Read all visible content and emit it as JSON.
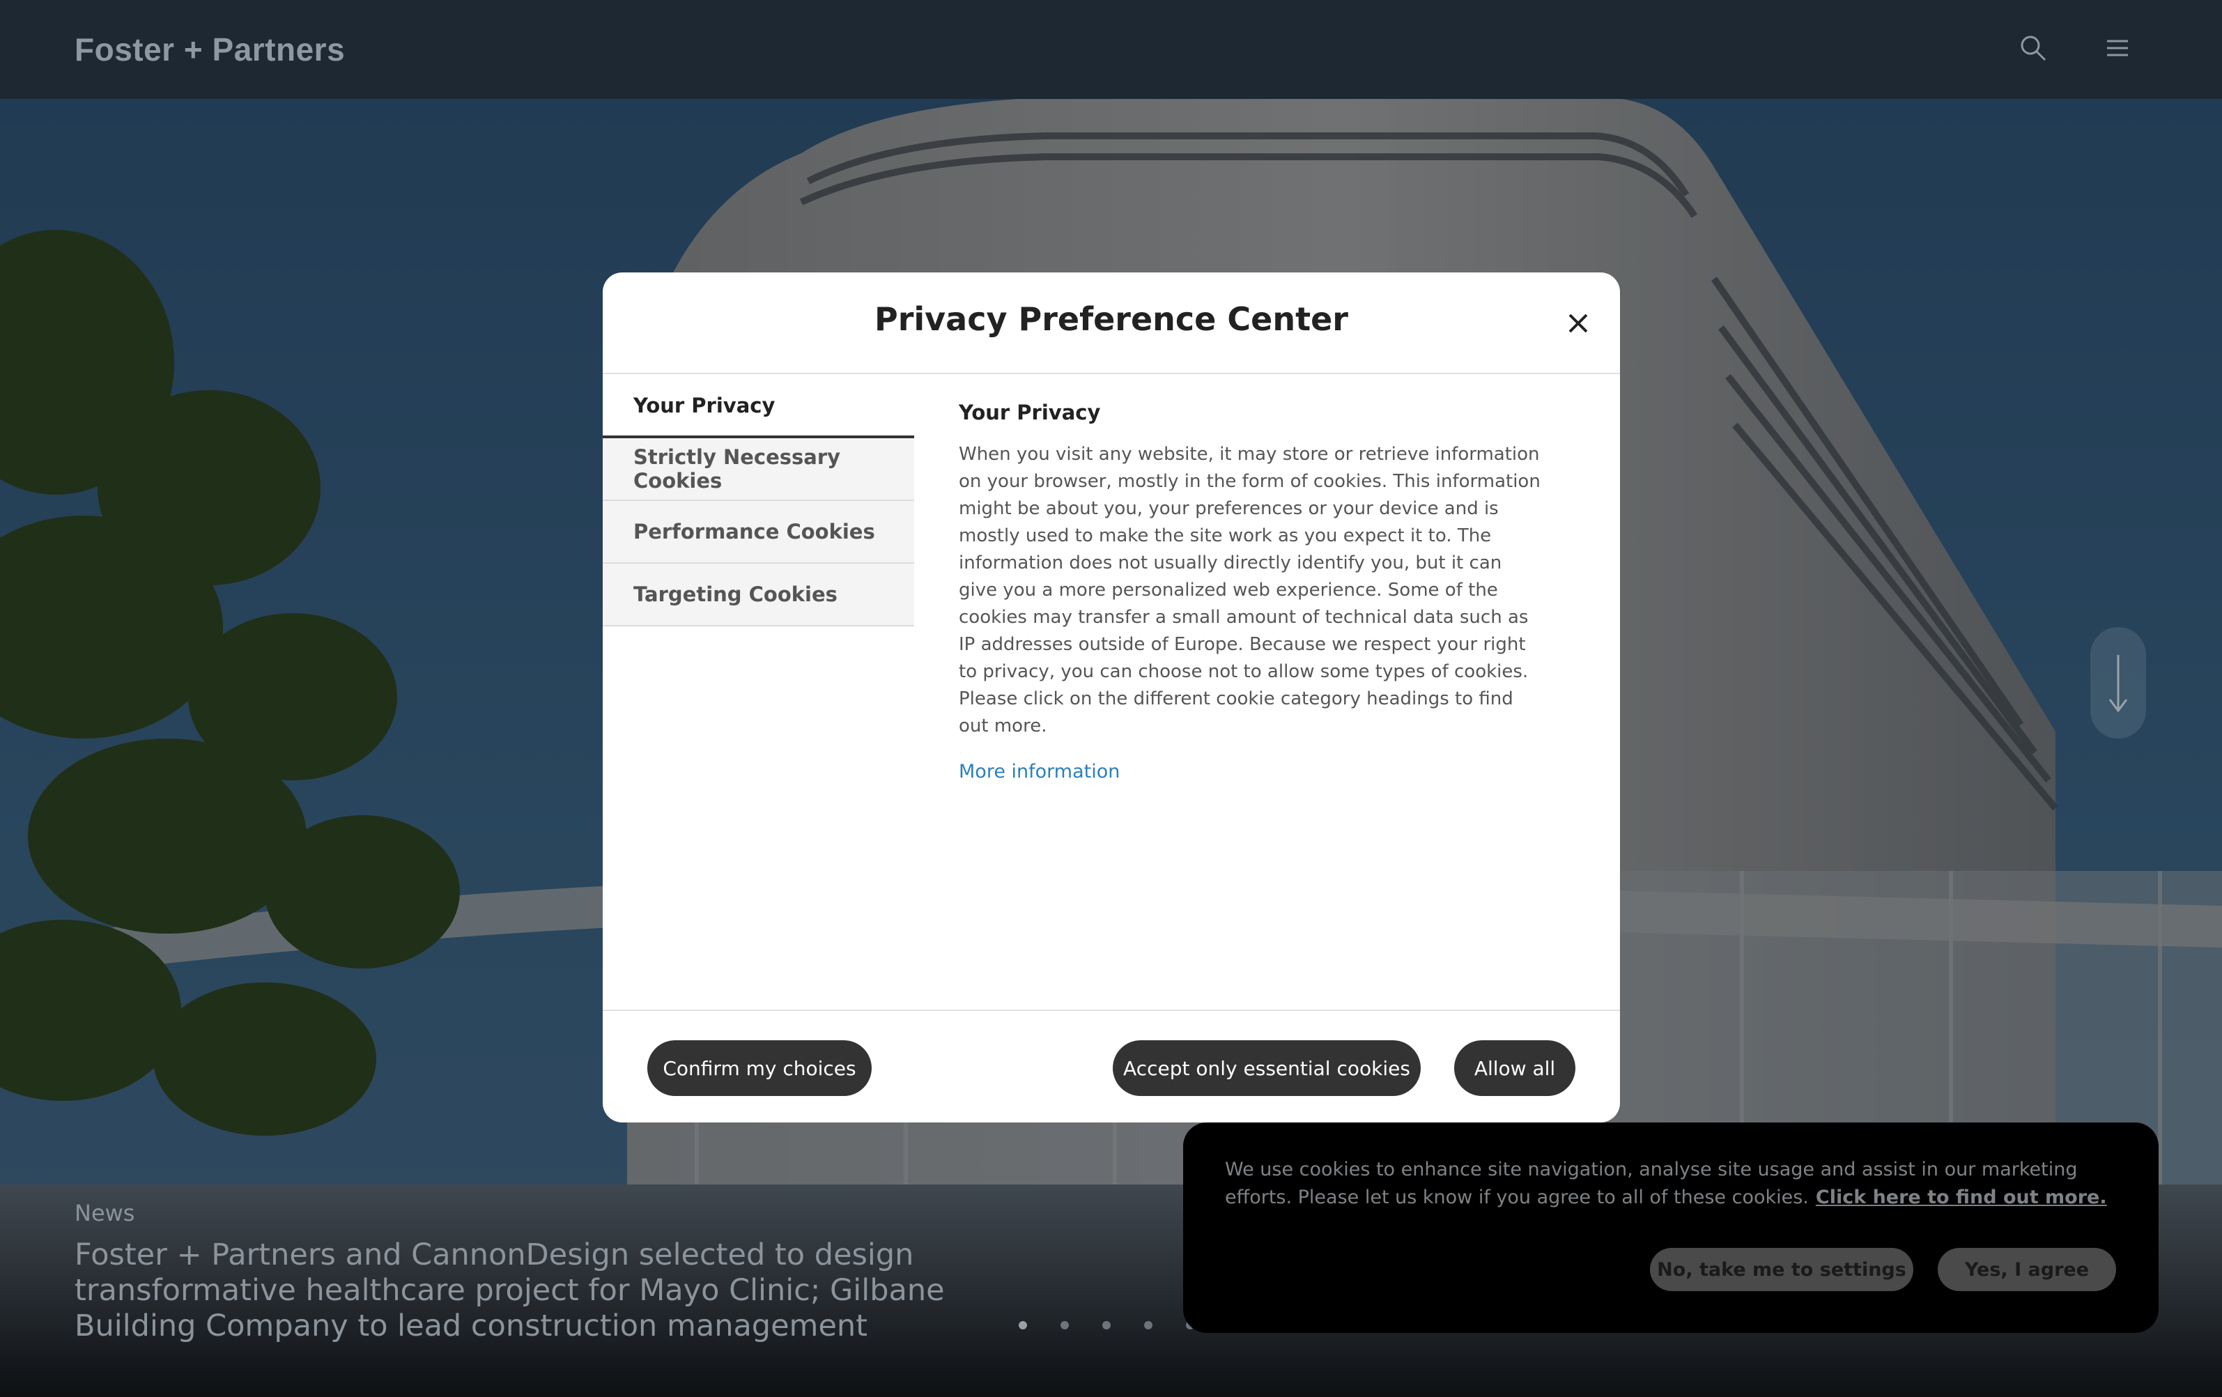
{
  "header": {
    "logo_text": "Foster + Partners",
    "search_icon": "search-icon",
    "menu_icon": "hamburger-menu-icon"
  },
  "hero": {
    "category": "News",
    "headline": "Foster + Partners and CannonDesign selected to design transformative healthcare project for Mayo Clinic; Gilbane Building Company to lead construction management",
    "slide_count": 5,
    "active_slide": 1,
    "scroll_icon": "arrow-down-icon"
  },
  "modal": {
    "title": "Privacy Preference Center",
    "close_icon": "close-icon",
    "tabs": [
      {
        "label": "Your Privacy",
        "active": true
      },
      {
        "label": "Strictly Necessary Cookies",
        "active": false
      },
      {
        "label": "Performance Cookies",
        "active": false
      },
      {
        "label": "Targeting Cookies",
        "active": false
      }
    ],
    "content": {
      "heading": "Your Privacy",
      "body": "When you visit any website, it may store or retrieve information on your browser, mostly in the form of cookies. This information might be about you, your preferences or your device and is mostly used to make the site work as you expect it to. The information does not usually directly identify you, but it can give you a more personalized web experience. Some of the cookies may transfer a small amount of technical data such as IP addresses outside of Europe. Because we respect your right to privacy, you can choose not to allow some types of cookies. Please click on the different cookie category headings to find out more.",
      "more_link": "More information"
    },
    "footer": {
      "confirm_label": "Confirm my choices",
      "essential_label": "Accept only essential cookies",
      "allow_label": "Allow all"
    }
  },
  "cookie_banner": {
    "text": "We use cookies to enhance site navigation, analyse site usage and assist in our marketing efforts. Please let us know if you agree to all of these cookies.",
    "link": "Click here to find out more.",
    "no_label": "No, take me to settings",
    "yes_label": "Yes, I agree"
  },
  "colors": {
    "header_bg": "#1d2833",
    "modal_bg": "#ffffff",
    "pill_bg": "#333333",
    "link": "#2c80b9",
    "banner_bg": "#000000"
  }
}
